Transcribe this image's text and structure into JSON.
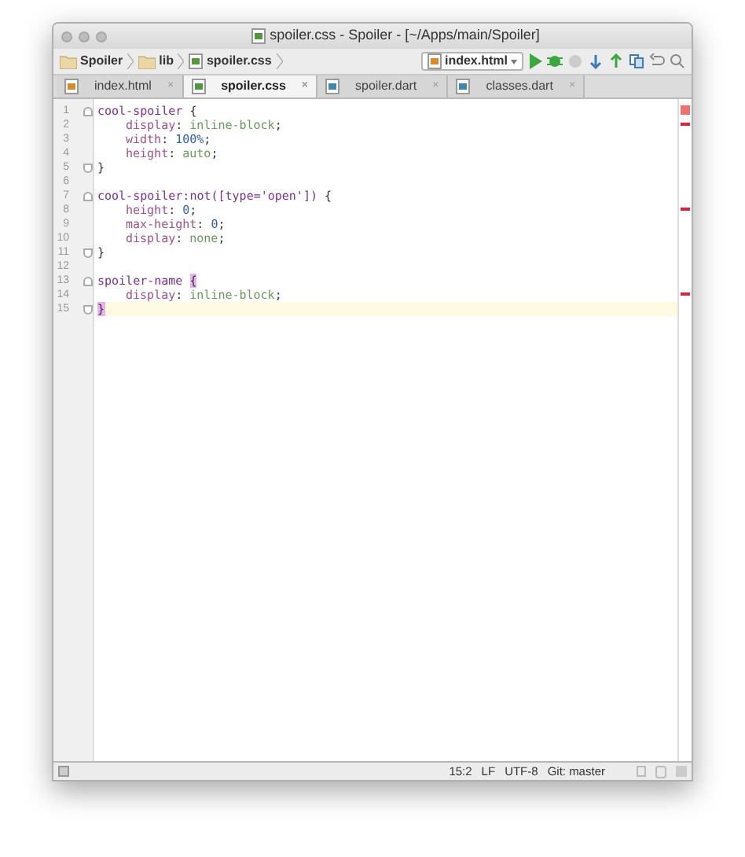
{
  "window": {
    "title": "spoiler.css - Spoiler - [~/Apps/main/Spoiler]"
  },
  "breadcrumbs": [
    {
      "label": "Spoiler",
      "kind": "folder"
    },
    {
      "label": "lib",
      "kind": "folder"
    },
    {
      "label": "spoiler.css",
      "kind": "css"
    }
  ],
  "run_config": {
    "label": "index.html"
  },
  "tabs": [
    {
      "label": "index.html",
      "kind": "html",
      "selected": false,
      "close": "×"
    },
    {
      "label": "spoiler.css",
      "kind": "css",
      "selected": true,
      "close": "×"
    },
    {
      "label": "spoiler.dart",
      "kind": "dart",
      "selected": false,
      "close": "×"
    },
    {
      "label": "classes.dart",
      "kind": "dart",
      "selected": false,
      "close": "×"
    }
  ],
  "lines": [
    {
      "number": "1",
      "kind": "fold-start",
      "current": false,
      "indented": false,
      "tokens": [
        {
          "kind": "selector",
          "text": "cool-spoiler"
        },
        {
          "kind": "punct",
          "text": " {"
        }
      ]
    },
    {
      "number": "2",
      "kind": "code",
      "current": false,
      "indented": true,
      "tokens": [
        {
          "kind": "property",
          "text": "display"
        },
        {
          "kind": "punct",
          "text": ": "
        },
        {
          "kind": "value",
          "text": "inline-block"
        },
        {
          "kind": "punct",
          "text": ";"
        }
      ]
    },
    {
      "number": "3",
      "kind": "code",
      "current": false,
      "indented": true,
      "tokens": [
        {
          "kind": "property",
          "text": "width"
        },
        {
          "kind": "punct",
          "text": ": "
        },
        {
          "kind": "number",
          "text": "100%"
        },
        {
          "kind": "punct",
          "text": ";"
        }
      ]
    },
    {
      "number": "4",
      "kind": "code",
      "current": false,
      "indented": true,
      "tokens": [
        {
          "kind": "property",
          "text": "height"
        },
        {
          "kind": "punct",
          "text": ": "
        },
        {
          "kind": "value",
          "text": "auto"
        },
        {
          "kind": "punct",
          "text": ";"
        }
      ]
    },
    {
      "number": "5",
      "kind": "fold-end",
      "current": false,
      "indented": false,
      "tokens": [
        {
          "kind": "punct",
          "text": "}"
        }
      ]
    },
    {
      "number": "6",
      "kind": "code",
      "current": false
    },
    {
      "number": "7",
      "kind": "fold-start",
      "current": false,
      "indented": false,
      "tokens": [
        {
          "kind": "selector",
          "text": "cool-spoiler:not([type='open'])"
        },
        {
          "kind": "punct",
          "text": " {"
        }
      ]
    },
    {
      "number": "8",
      "kind": "code",
      "current": false,
      "indented": true,
      "tokens": [
        {
          "kind": "property",
          "text": "height"
        },
        {
          "kind": "punct",
          "text": ": "
        },
        {
          "kind": "number",
          "text": "0"
        },
        {
          "kind": "punct",
          "text": ";"
        }
      ]
    },
    {
      "number": "9",
      "kind": "code",
      "current": false,
      "indented": true,
      "tokens": [
        {
          "kind": "property",
          "text": "max-height"
        },
        {
          "kind": "punct",
          "text": ": "
        },
        {
          "kind": "number",
          "text": "0"
        },
        {
          "kind": "punct",
          "text": ";"
        }
      ]
    },
    {
      "number": "10",
      "kind": "code",
      "current": false,
      "indented": true,
      "tokens": [
        {
          "kind": "property",
          "text": "display"
        },
        {
          "kind": "punct",
          "text": ": "
        },
        {
          "kind": "value",
          "text": "none"
        },
        {
          "kind": "punct",
          "text": ";"
        }
      ]
    },
    {
      "number": "11",
      "kind": "fold-end",
      "current": false,
      "indented": false,
      "tokens": [
        {
          "kind": "punct",
          "text": "}"
        }
      ]
    },
    {
      "number": "12",
      "kind": "code",
      "current": false
    },
    {
      "number": "13",
      "kind": "fold-start",
      "current": false,
      "indented": false,
      "tokens": [
        {
          "kind": "selector",
          "text": "spoiler-name"
        },
        {
          "kind": "brace",
          "text": "{"
        }
      ]
    },
    {
      "number": "14",
      "kind": "code",
      "current": false,
      "indented": true,
      "tokens": [
        {
          "kind": "property",
          "text": "display"
        },
        {
          "kind": "punct",
          "text": ": "
        },
        {
          "kind": "value",
          "text": "inline-block"
        },
        {
          "kind": "punct",
          "text": ";"
        }
      ]
    },
    {
      "number": "15",
      "kind": "fold-end",
      "current": true,
      "indented": false,
      "tokens": [
        {
          "kind": "brace",
          "text": "}"
        }
      ]
    }
  ],
  "status_bar": {
    "position": "15:2",
    "line_ending": "LF",
    "encoding": "UTF-8",
    "vcs": "Git: master"
  }
}
